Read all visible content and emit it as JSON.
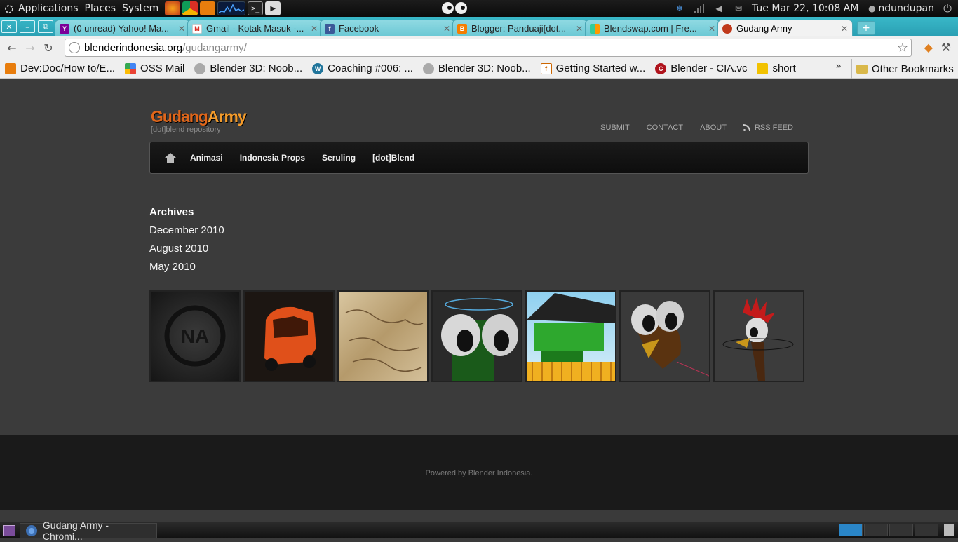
{
  "top_panel": {
    "menus": [
      "Applications",
      "Places",
      "System"
    ],
    "clock": "Tue Mar 22, 10:08 AM",
    "user": "ndundupan"
  },
  "window": {
    "tabs": [
      {
        "title": "(0 unread) Yahoo! Ma...",
        "icon": "yahoo-icon",
        "active": false
      },
      {
        "title": "Gmail - Kotak Masuk -...",
        "icon": "gmail-icon",
        "active": false
      },
      {
        "title": "Facebook",
        "icon": "facebook-icon",
        "active": false
      },
      {
        "title": "Blogger: Panduaji[dot...",
        "icon": "blogger-icon",
        "active": false
      },
      {
        "title": "Blendswap.com | Fre...",
        "icon": "blendswap-icon",
        "active": false
      },
      {
        "title": "Gudang Army",
        "icon": "gudang-icon",
        "active": true
      }
    ],
    "address": {
      "host": "blenderindonesia.org",
      "path": "/gudangarmy/"
    },
    "bookmarks": [
      {
        "label": "Dev:Doc/How to/E...",
        "icon": "blender-icon"
      },
      {
        "label": "OSS Mail",
        "icon": "google-icon"
      },
      {
        "label": "Blender 3D: Noob...",
        "icon": "wikibooks-icon"
      },
      {
        "label": "Coaching #006: ...",
        "icon": "wordpress-icon"
      },
      {
        "label": "Blender 3D: Noob...",
        "icon": "wikibooks-icon"
      },
      {
        "label": "Getting Started w...",
        "icon": "doc-icon"
      },
      {
        "label": "Blender - CIA.vc",
        "icon": "cia-icon"
      },
      {
        "label": "short",
        "icon": "bee-icon"
      }
    ],
    "other_bookmarks": "Other Bookmarks"
  },
  "site": {
    "logo": {
      "part1": "Gudang",
      "part2": "Army",
      "tagline": "[dot]blend repository"
    },
    "top_links": [
      "SUBMIT",
      "CONTACT",
      "ABOUT",
      "RSS FEED"
    ],
    "nav": [
      "Animasi",
      "Indonesia Props",
      "Seruling",
      "[dot]Blend"
    ],
    "archives": {
      "heading": "Archives",
      "months": [
        "December 2010",
        "August 2010",
        "May 2010"
      ]
    },
    "footer": "Powered by Blender Indonesia."
  },
  "taskbar": {
    "item": "Gudang Army - Chromi..."
  },
  "colors": {
    "tabstrip": "#2a9fb3",
    "logo_orange": "#e0661a",
    "page_bg": "#3b3b3b",
    "footer_bg": "#1a1a1a"
  }
}
